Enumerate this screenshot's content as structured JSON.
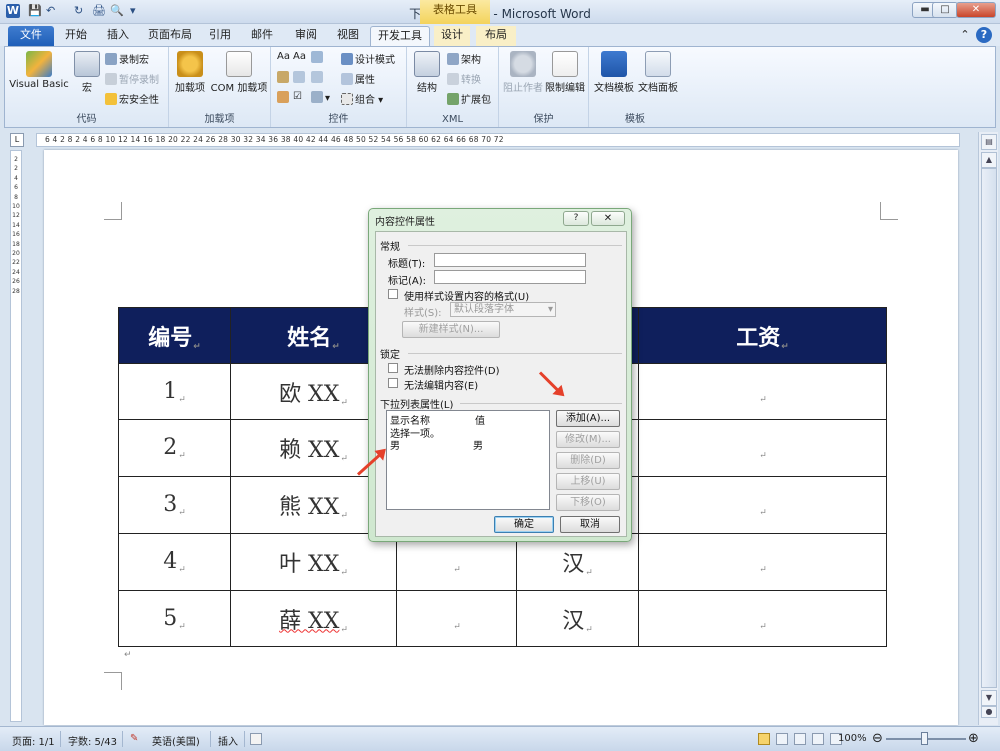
{
  "window": {
    "title": "下拉选项.docx - Microsoft Word",
    "context_group": "表格工具",
    "qat": [
      "W",
      "💾",
      "↶",
      "↻",
      "🖨",
      "🔍",
      "▾"
    ],
    "controls": {
      "minimize": "▬",
      "maximize": "□",
      "close": "✕"
    }
  },
  "tabs": [
    {
      "label": "文件"
    },
    {
      "label": "开始"
    },
    {
      "label": "插入"
    },
    {
      "label": "页面布局"
    },
    {
      "label": "引用"
    },
    {
      "label": "邮件"
    },
    {
      "label": "审阅"
    },
    {
      "label": "视图"
    },
    {
      "label": "开发工具"
    },
    {
      "label": "设计"
    },
    {
      "label": "布局"
    }
  ],
  "tab_right": {
    "collapse": "⌃",
    "help": "?"
  },
  "ribbon": {
    "code": {
      "label": "代码",
      "vb": "Visual Basic",
      "macros": "宏",
      "record": "录制宏",
      "pause": "暂停录制",
      "security": "宏安全性"
    },
    "addins": {
      "label": "加载项",
      "addins": "加载项",
      "com": "COM 加载项"
    },
    "controls": {
      "label": "控件",
      "design_mode": "设计模式",
      "properties": "属性",
      "group": "组合"
    },
    "xml": {
      "label": "XML",
      "structure": "结构",
      "schema": "架构",
      "transform": "转换",
      "expansion": "扩展包"
    },
    "protect": {
      "label": "保护",
      "block": "阻止作者",
      "restrict": "限制编辑"
    },
    "templates": {
      "label": "模板",
      "doc_template": "文档模板",
      "doc_panel": "文档面板"
    }
  },
  "ruler": {
    "h_text": "6  4  2  8  2  4  6  8  10  12  14  16  18  20  22  24  26  28  30  32  34  36  38  40  42  44  46  48  50  52  54  56  58  60  62  64  66  68  70  72",
    "v_text": "2\n2\n4\n6\n8\n10\n12\n14\n16\n18\n20\n22\n24\n26\n28"
  },
  "table": {
    "header": [
      "编号",
      "姓名",
      "",
      "",
      "工资"
    ],
    "rows": [
      {
        "id": "1",
        "name": "欧 XX",
        "eth": ""
      },
      {
        "id": "2",
        "name": "赖 XX",
        "eth": ""
      },
      {
        "id": "3",
        "name": "熊 XX",
        "eth": ""
      },
      {
        "id": "4",
        "name": "叶 XX",
        "eth": "汉"
      },
      {
        "id": "5",
        "name": "薛 XX",
        "eth": "汉"
      }
    ]
  },
  "dialog": {
    "title": "内容控件属性",
    "help": "?",
    "close": "✕",
    "general": "常规",
    "title_label": "标题(T):",
    "tag_label": "标记(A):",
    "title_value": "",
    "tag_value": "",
    "use_style": "使用样式设置内容的格式(U)",
    "style_label": "样式(S):",
    "style_value": "默认段落字体",
    "new_style": "新建样式(N)...",
    "locking": "锁定",
    "no_delete": "无法删除内容控件(D)",
    "no_edit": "无法编辑内容(E)",
    "dropdown_props": "下拉列表属性(L)",
    "col_display": "显示名称",
    "col_value": "值",
    "items": [
      {
        "display": "选择一项。",
        "value": ""
      },
      {
        "display": "男",
        "value": "男"
      }
    ],
    "btn_add": "添加(A)...",
    "btn_modify": "修改(M)...",
    "btn_delete": "删除(D)",
    "btn_up": "上移(U)",
    "btn_down": "下移(O)",
    "btn_ok": "确定",
    "btn_cancel": "取消"
  },
  "status": {
    "page": "页面: 1/1",
    "words": "字数: 5/43",
    "language": "英语(美国)",
    "mode": "插入",
    "zoom": "100%",
    "zoom_level": 1.0
  },
  "colors": {
    "table_header": "#0f1f5c",
    "annotation_arrow": "#e5402a",
    "file_tab": "#2b6ac2"
  }
}
